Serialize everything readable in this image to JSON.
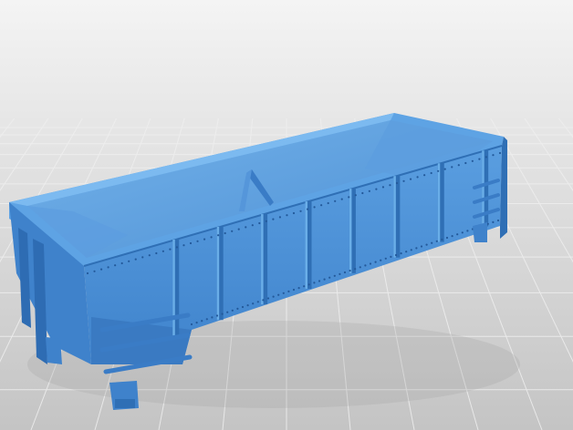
{
  "scene": {
    "subject": "hopper-car-3d-model",
    "colors": {
      "model_base": "#4a8fd6",
      "model_light": "#6aaee8",
      "model_dark": "#2f6fb5",
      "model_shadow": "#23599a",
      "background_top": "#f2f2f2",
      "floor": "#c9c9c9",
      "grid_line": "#e6e6e6"
    },
    "vertical_stakes": 8,
    "ladder_rungs": 3
  }
}
